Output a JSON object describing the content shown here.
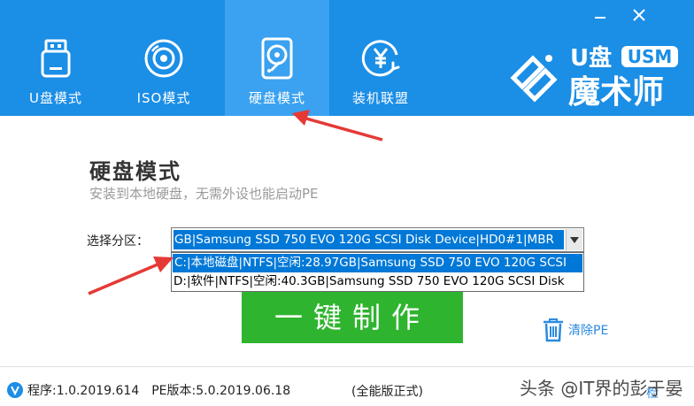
{
  "window": {
    "minimize_icon": "minimize-icon",
    "close_icon": "close-icon"
  },
  "nav": {
    "tabs": [
      {
        "label": "U盘模式",
        "icon": "usb-drive-icon",
        "active": false
      },
      {
        "label": "ISO模式",
        "icon": "disc-icon",
        "active": false
      },
      {
        "label": "硬盘模式",
        "icon": "hard-disk-icon",
        "active": true
      },
      {
        "label": "装机联盟",
        "icon": "yen-coin-icon",
        "active": false
      }
    ]
  },
  "logo": {
    "text_top": "U盘",
    "badge": "USM",
    "text_bottom": "魔术师"
  },
  "content": {
    "title": "硬盘模式",
    "subtitle": "安装到本地硬盘，无需外设也能启动PE"
  },
  "partition": {
    "label": "选择分区：",
    "selected": "GB|Samsung SSD 750 EVO 120G SCSI Disk Device|HD0#1|MBR",
    "options": [
      "C:|本地磁盘|NTFS|空闲:28.97GB|Samsung SSD 750 EVO 120G SCSI",
      "D:|软件|NTFS|空闲:40.3GB|Samsung SSD 750 EVO 120G SCSI Disk"
    ]
  },
  "actions": {
    "make_label": "一键制作",
    "clear_pe_label": "清除PE"
  },
  "status": {
    "program_version": "程序:1.0.2019.614",
    "pe_version": "PE版本:5.0.2019.06.18",
    "edition": "(全能版正式)",
    "update_label": "检",
    "watermark": "头条 @IT界的彭于晏"
  },
  "colors": {
    "header_blue": "#1b8ee6",
    "active_tab": "#3aa2f0",
    "select_highlight": "#0078d7",
    "button_green": "#2fb42f",
    "link_blue": "#2a8ae0",
    "annotation_red": "#e53935"
  }
}
